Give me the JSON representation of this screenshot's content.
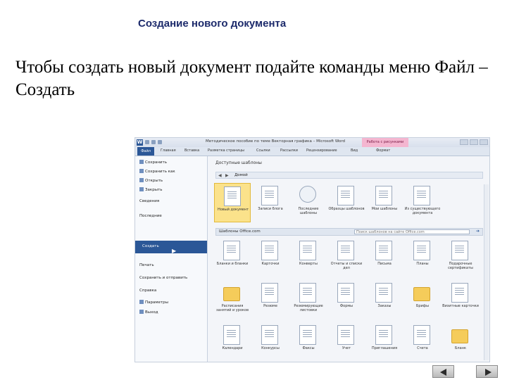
{
  "slide": {
    "title": "Создание нового документа",
    "body": "Чтобы создать новый документ подайте команды меню Файл – Создать"
  },
  "word": {
    "window_title": "Методическое пособие по теме Векторная графика – Microsoft Word",
    "context_tab": "Работа с рисунками",
    "ribbon_tabs": [
      "Файл",
      "Главная",
      "Вставка",
      "Разметка страницы",
      "Ссылки",
      "Рассылки",
      "Рецензирование",
      "Вид",
      "Формат"
    ],
    "nav": {
      "save": "Сохранить",
      "save_as": "Сохранить как",
      "open": "Открыть",
      "close": "Закрыть",
      "info": "Сведения",
      "recent": "Последние",
      "new": "Создать",
      "print": "Печать",
      "save_send": "Сохранить и отправить",
      "help": "Справка",
      "options": "Параметры",
      "exit": "Выход"
    },
    "available_templates_title": "Доступные шаблоны",
    "home_label": "Домой",
    "top_templates": [
      "Новый документ",
      "Записи блога",
      "Последние шаблоны",
      "Образцы шаблонов",
      "Мои шаблоны",
      "Из существующего документа"
    ],
    "office_section_label": "Шаблоны Office.com",
    "search_placeholder": "Поиск шаблонов на сайте Office.com",
    "office_templates": [
      "Бланки и бланки",
      "Карточки",
      "Конверты",
      "Отчеты и списки дел",
      "Письма",
      "Планы",
      "Подарочные сертификаты",
      "Расписания занятий и уроков",
      "Резюме",
      "Резюмирующие листовки",
      "Формы",
      "Заказы",
      "Брифы",
      "Визитные карточки",
      "Календари",
      "Конкурсы",
      "Факсы",
      "Учет",
      "Приглашения",
      "Счета",
      "Бланк"
    ]
  }
}
